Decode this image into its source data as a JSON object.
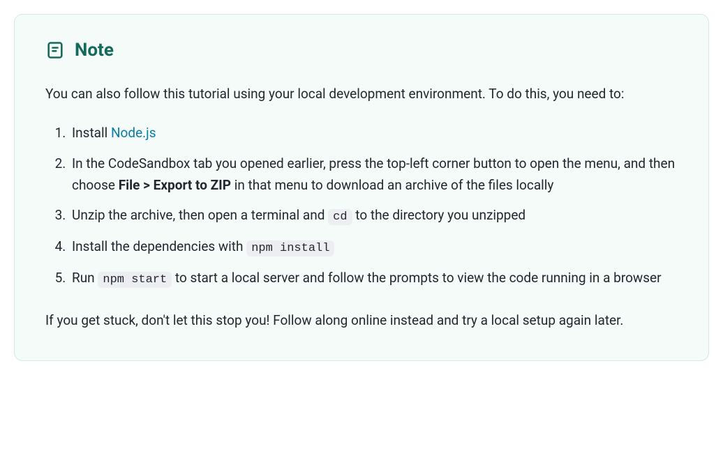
{
  "note": {
    "title": "Note",
    "intro": "You can also follow this tutorial using your local development environment. To do this, you need to:",
    "steps": {
      "s1_prefix": "Install ",
      "s1_link": "Node.js",
      "s2_a": "In the CodeSandbox tab you opened earlier, press the top-left corner button to open the menu, and then choose ",
      "s2_bold": "File > Export to ZIP",
      "s2_b": " in that menu to download an archive of the files locally",
      "s3_a": "Unzip the archive, then open a terminal and ",
      "s3_code": "cd",
      "s3_b": " to the directory you unzipped",
      "s4_a": "Install the dependencies with ",
      "s4_code": "npm install",
      "s5_a": "Run ",
      "s5_code": "npm start",
      "s5_b": " to start a local server and follow the prompts to view the code running in a browser"
    },
    "outro": "If you get stuck, don't let this stop you! Follow along online instead and try a local setup again later."
  }
}
